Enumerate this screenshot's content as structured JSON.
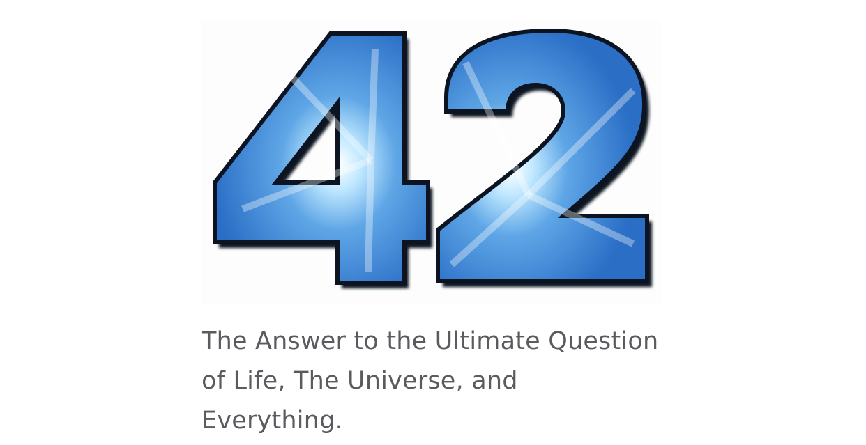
{
  "hero_image": {
    "text": "42",
    "icon": "starburst-number-42-image",
    "colors": {
      "fill_dark": "#2a6ec6",
      "fill_mid": "#4f95dc",
      "fill_light": "#dff3ff",
      "outline": "#0b1420"
    }
  },
  "caption": {
    "line1": "The Answer to the Ultimate Question",
    "line2": "of Life, The Universe, and",
    "line3": "Everything."
  }
}
